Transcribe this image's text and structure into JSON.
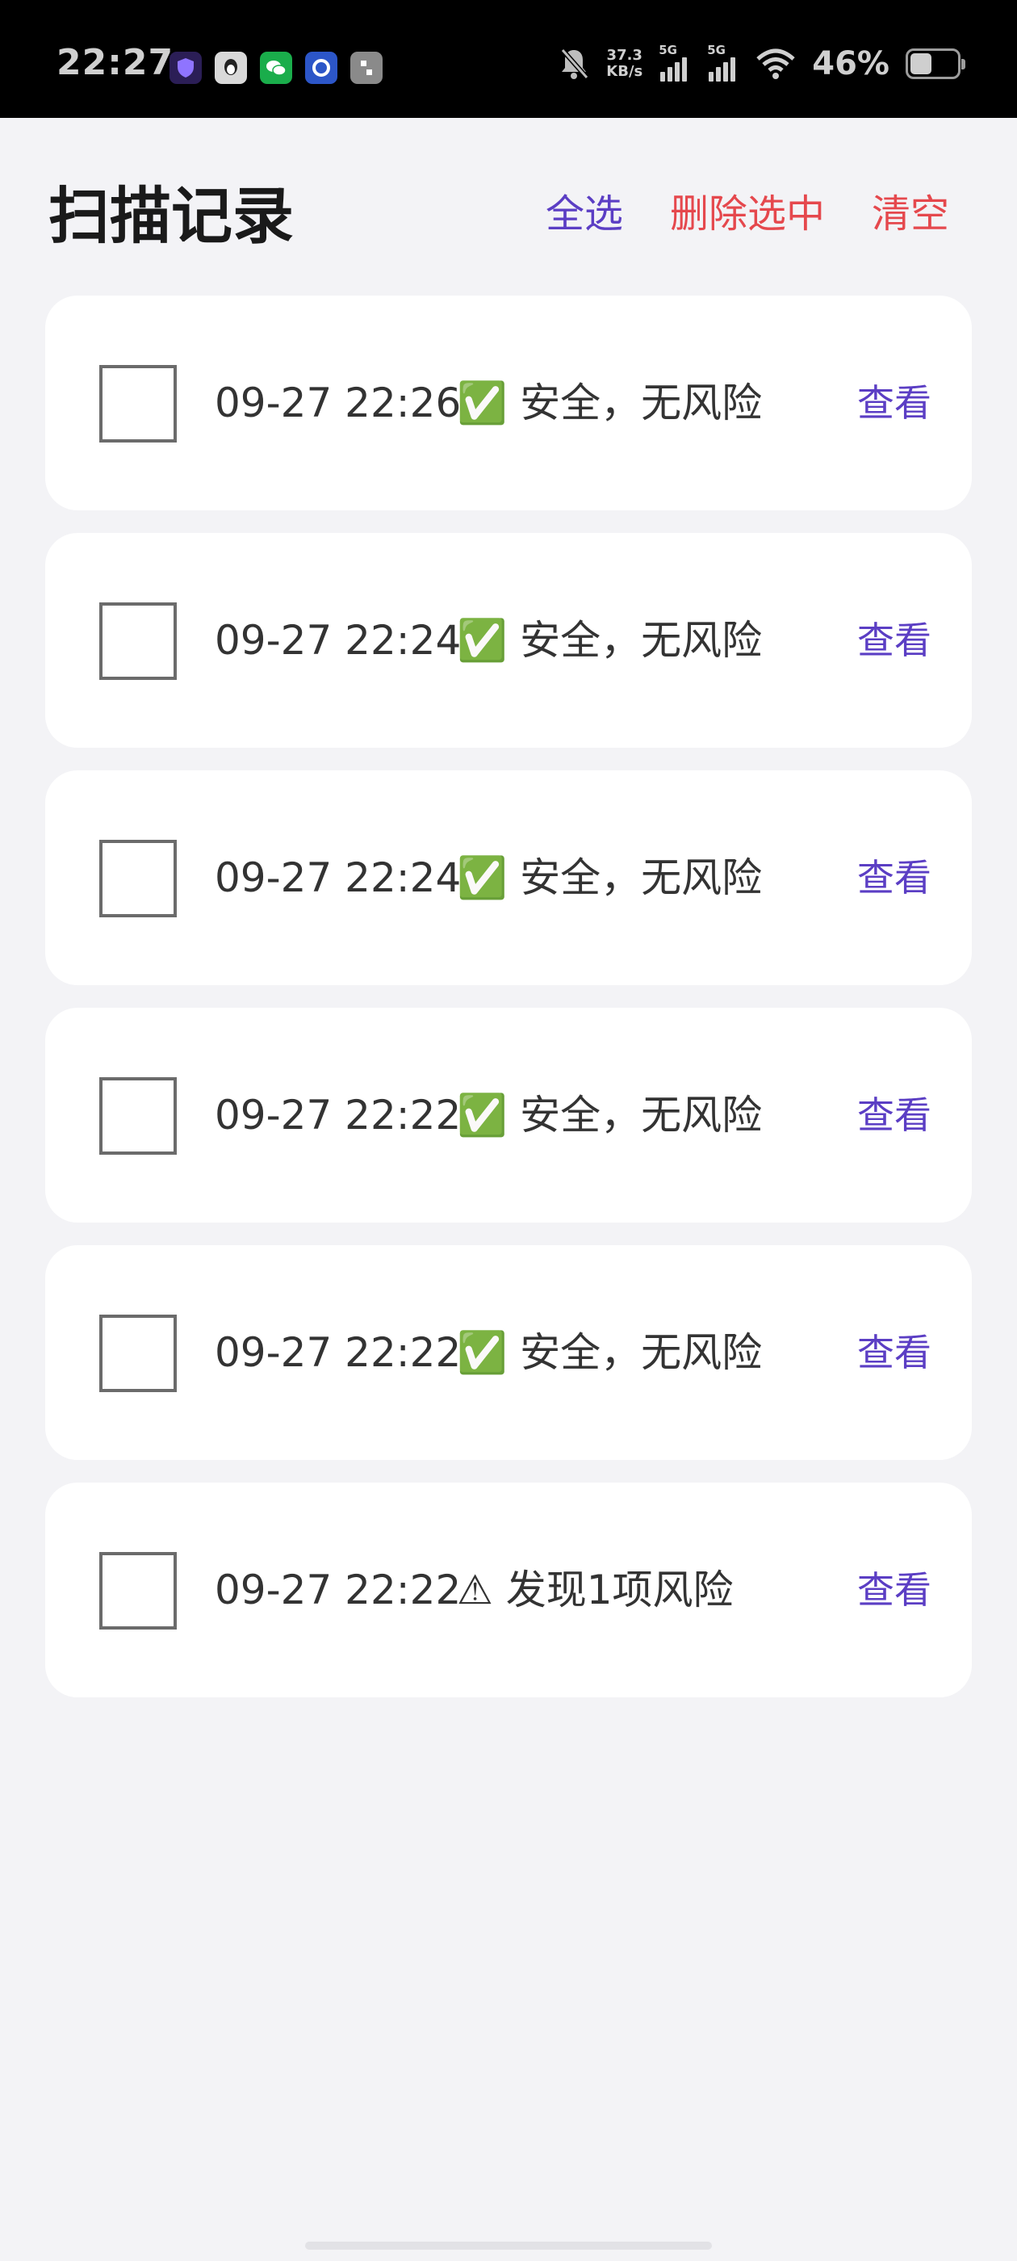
{
  "status_bar": {
    "time": "22:27",
    "net_speed_value": "37.3",
    "net_speed_unit": "KB/s",
    "sim1_label": "5G",
    "sim2_label": "5G",
    "battery_percent": "46%",
    "battery_level": 0.46,
    "notification_icons": [
      "shield-app-icon",
      "qq-icon",
      "wechat-icon",
      "blue-app-icon",
      "grey-app-icon"
    ]
  },
  "header": {
    "title": "扫描记录",
    "select_all_label": "全选",
    "delete_selected_label": "删除选中",
    "clear_label": "清空"
  },
  "records": [
    {
      "time": "09-27 22:26",
      "status": "✅ 安全，无风险",
      "view_label": "查看",
      "checked": false
    },
    {
      "time": "09-27 22:24",
      "status": "✅ 安全，无风险",
      "view_label": "查看",
      "checked": false
    },
    {
      "time": "09-27 22:24",
      "status": "✅ 安全，无风险",
      "view_label": "查看",
      "checked": false
    },
    {
      "time": "09-27 22:22",
      "status": "✅ 安全，无风险",
      "view_label": "查看",
      "checked": false
    },
    {
      "time": "09-27 22:22",
      "status": "✅ 安全，无风险",
      "view_label": "查看",
      "checked": false
    },
    {
      "time": "09-27 22:22",
      "status": "⚠ 发现1项风险",
      "view_label": "查看",
      "checked": false
    }
  ],
  "colors": {
    "accent": "#5b3ec4",
    "danger": "#e5484d",
    "background": "#f3f3f6",
    "card": "#ffffff"
  }
}
